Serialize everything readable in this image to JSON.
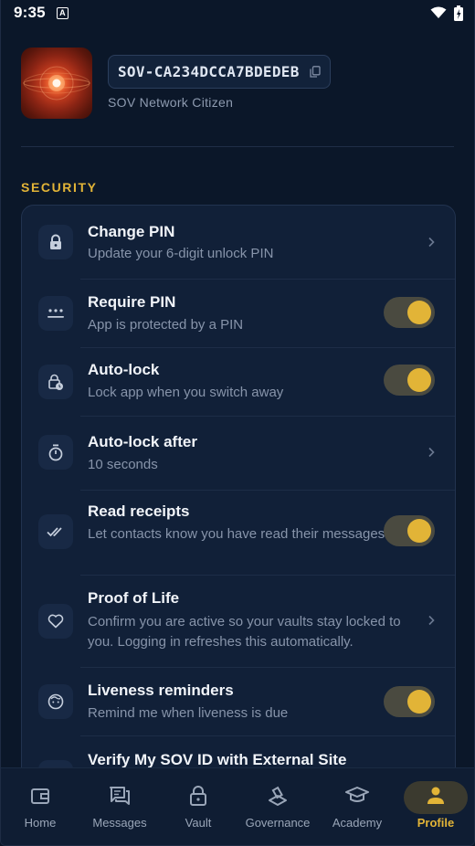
{
  "status_bar": {
    "time": "9:35",
    "badge": "A"
  },
  "profile": {
    "id": "SOV-CA234DCCA7BDEDEB",
    "subtitle": "SOV Network Citizen"
  },
  "section": {
    "title": "SECURITY"
  },
  "rows": [
    {
      "title": "Change PIN",
      "desc": "Update your 6-digit unlock PIN",
      "icon": "lock-icon",
      "control": "chevron"
    },
    {
      "title": "Require PIN",
      "desc": "App is protected by a PIN",
      "icon": "pin-dots-icon",
      "control": "toggle",
      "on": true
    },
    {
      "title": "Auto-lock",
      "desc": "Lock app when you switch away",
      "icon": "lock-clock-icon",
      "control": "toggle",
      "on": true
    },
    {
      "title": "Auto-lock after",
      "desc": "10 seconds",
      "icon": "timer-icon",
      "control": "chevron"
    },
    {
      "title": "Read receipts",
      "desc": "Let contacts know you have read their messages",
      "icon": "double-check-icon",
      "control": "toggle",
      "on": true
    },
    {
      "title": "Proof of Life",
      "desc": "Confirm you are active so your vaults stay locked to you. Logging in refreshes this automatically.",
      "icon": "heart-icon",
      "control": "chevron"
    },
    {
      "title": "Liveness reminders",
      "desc": "Remind me when liveness is due",
      "icon": "face-icon",
      "control": "toggle",
      "on": true
    },
    {
      "title": "Verify My SOV ID with External Site",
      "desc": "",
      "icon": "external-icon",
      "control": "chevron"
    }
  ],
  "nav": [
    {
      "label": "Home",
      "icon": "wallet-icon"
    },
    {
      "label": "Messages",
      "icon": "messages-icon"
    },
    {
      "label": "Vault",
      "icon": "vault-lock-icon"
    },
    {
      "label": "Governance",
      "icon": "governance-icon"
    },
    {
      "label": "Academy",
      "icon": "academy-icon"
    },
    {
      "label": "Profile",
      "icon": "profile-icon",
      "active": true
    }
  ],
  "colors": {
    "accent": "#e2b437",
    "background": "#0b1729",
    "card": "#112038"
  }
}
